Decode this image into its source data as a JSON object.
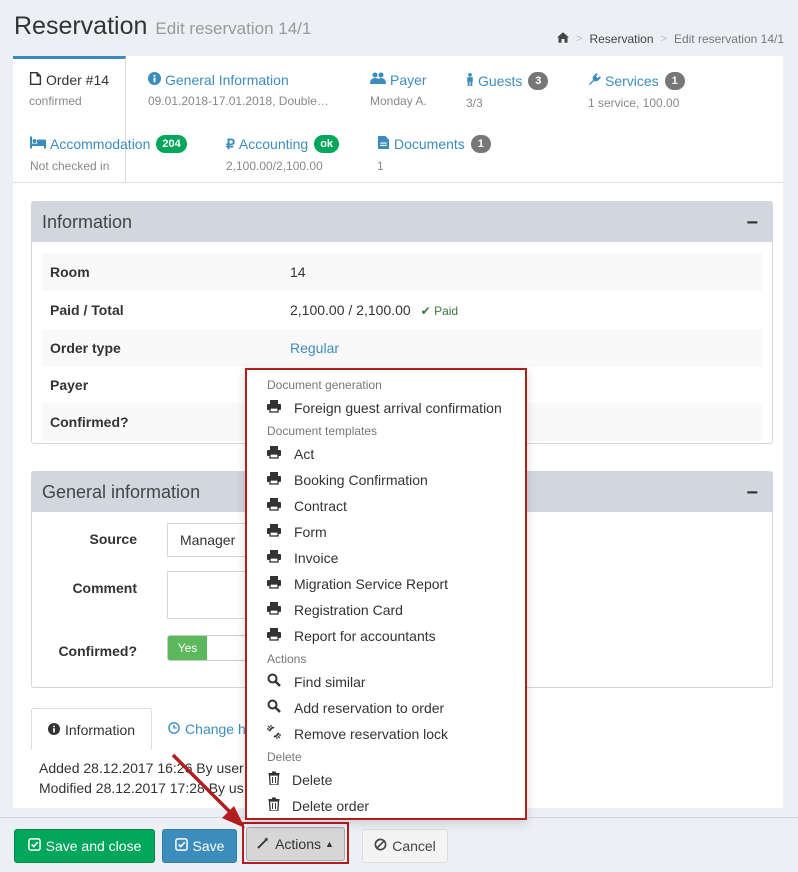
{
  "header": {
    "title": "Reservation",
    "subtitle": "Edit reservation 14/1",
    "breadcrumb": {
      "home_icon": "home-icon",
      "item1": "Reservation",
      "item2": "Edit reservation 14/1"
    }
  },
  "tabs": [
    {
      "title": "Order #14",
      "sub": "confirmed",
      "icon": "file-icon",
      "badge": ""
    },
    {
      "title": "General Information",
      "sub": "09.01.2018-17.01.2018, Double…",
      "icon": "info-icon",
      "badge": ""
    },
    {
      "title": "Payer",
      "sub": "Monday A.",
      "icon": "users-icon",
      "badge": ""
    },
    {
      "title": "Guests",
      "sub": "3/3",
      "icon": "person-icon",
      "badge": "3"
    },
    {
      "title": "Services",
      "sub": "1 service, 100.00",
      "icon": "plug-icon",
      "badge": "1"
    },
    {
      "title": "Accommodation",
      "sub": "Not checked in",
      "icon": "bed-icon",
      "badge": "204"
    },
    {
      "title": "Accounting",
      "sub": "2,100.00/2,100.00",
      "icon": "ruble-icon",
      "badge": "ok"
    },
    {
      "title": "Documents",
      "sub": "1",
      "icon": "document-icon",
      "badge": "1"
    }
  ],
  "information": {
    "title": "Information",
    "collapse": "−",
    "rows": [
      {
        "label": "Room",
        "value": "14"
      },
      {
        "label": "Paid / Total",
        "value": "2,100.00 / 2,100.00",
        "status": "Paid"
      },
      {
        "label": "Order type",
        "value": "Regular"
      },
      {
        "label": "Payer",
        "value": ""
      },
      {
        "label": "Confirmed?",
        "value": ""
      }
    ]
  },
  "general_information": {
    "title": "General information",
    "collapse": "−",
    "source_label": "Source",
    "source_value": "Manager",
    "comment_label": "Comment",
    "comment_value": "",
    "confirmed_label": "Confirmed?",
    "confirmed_toggle": "Yes"
  },
  "bottom_tabs": {
    "information": "Information",
    "change_history": "Change h"
  },
  "log": {
    "added": "Added 28.12.2017 16:26 By user",
    "modified": "Modified 28.12.2017 17:28 By us"
  },
  "dropdown": {
    "headers": [
      "Document generation",
      "Document templates",
      "Actions",
      "Delete"
    ],
    "document_generation": [
      "Foreign guest arrival confirmation"
    ],
    "document_templates": [
      "Act",
      "Booking Confirmation",
      "Contract",
      "Form",
      "Invoice",
      "Migration Service Report",
      "Registration Card",
      "Report for accountants"
    ],
    "actions": [
      "Find similar",
      "Add reservation to order",
      "Remove reservation lock"
    ],
    "delete": [
      "Delete",
      "Delete order"
    ]
  },
  "footer": {
    "save_close": "Save and close",
    "save": "Save",
    "actions": "Actions",
    "cancel": "Cancel"
  },
  "colors": {
    "primary": "#3c8dbc",
    "success": "#00a65a",
    "highlight": "#b01e1e",
    "badge_gray": "#777777"
  }
}
